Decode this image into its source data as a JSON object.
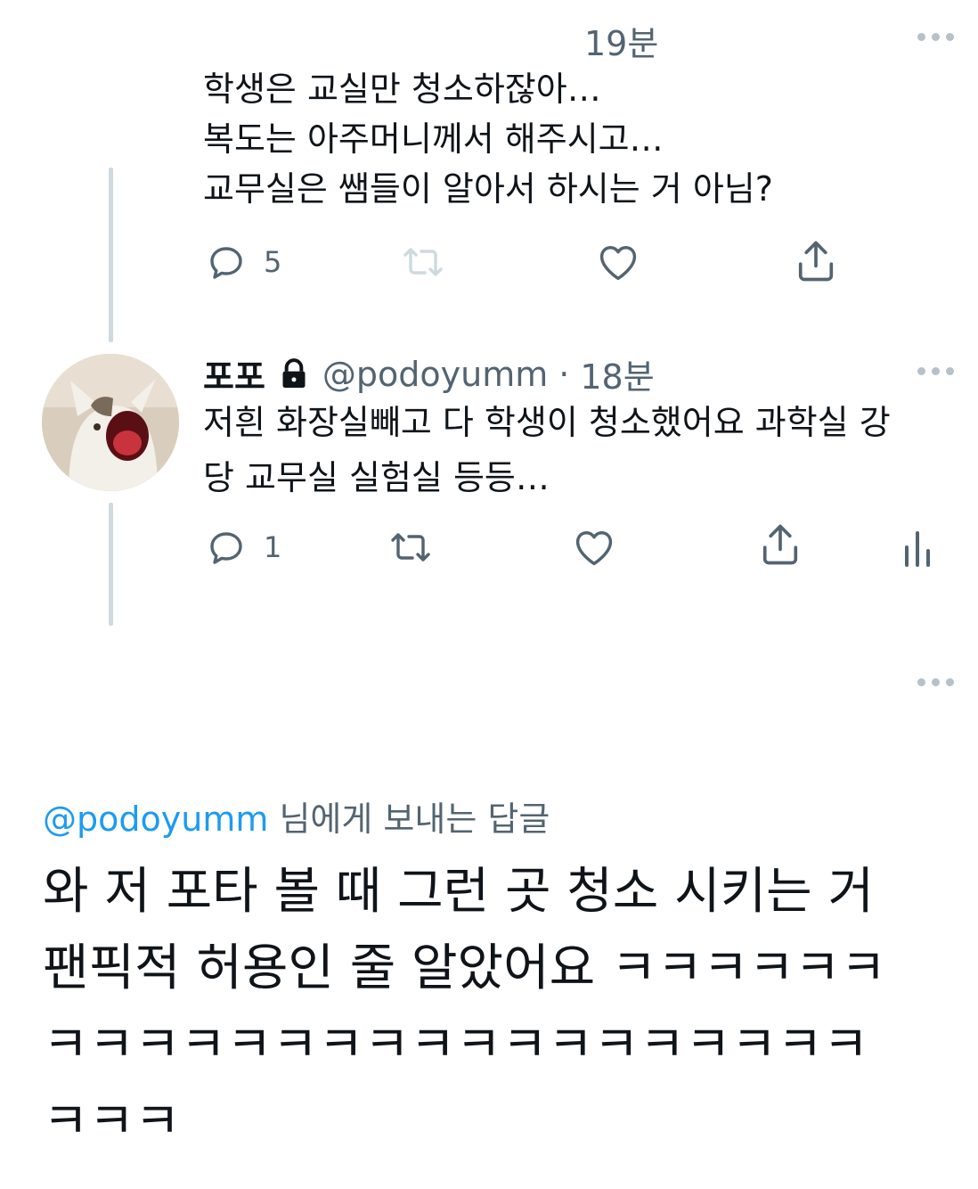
{
  "tweet1": {
    "time": "19분",
    "text": "학생은 교실만 청소하잖아…\n복도는 아주머니께서 해주시고…\n교무실은 쌤들이 알아서 하시는 거 아님?",
    "reply_count": "5"
  },
  "tweet2": {
    "name": "포포",
    "handle": "@podoyumm",
    "separator": "·",
    "time": "18분",
    "text": "저흰 화장실빼고 다 학생이 청소했어요 과학실 강\n당 교무실 실험실 등등…",
    "reply_count": "1"
  },
  "compose": {
    "reply_mention": "@podoyumm",
    "reply_suffix": " 님에게 보내는 답글",
    "text": "와 저 포타 볼 때 그런 곳 청소 시키는 거\n팬픽적 허용인 줄 알았어요 ㅋㅋㅋㅋㅋㅋ\nㅋㅋㅋㅋㅋㅋㅋㅋㅋㅋㅋㅋㅋㅋㅋㅋㅋㅋ\nㅋㅋㅋ"
  },
  "icons": {
    "reply": "reply-icon",
    "retweet": "retweet-icon",
    "like": "heart-icon",
    "share": "share-icon",
    "analytics": "analytics-icon",
    "lock": "lock-icon",
    "more": "more-icon"
  },
  "colors": {
    "text": "#0f1419",
    "secondary": "#536471",
    "accent": "#1d9bf0",
    "thread_line": "#cfd9de"
  }
}
